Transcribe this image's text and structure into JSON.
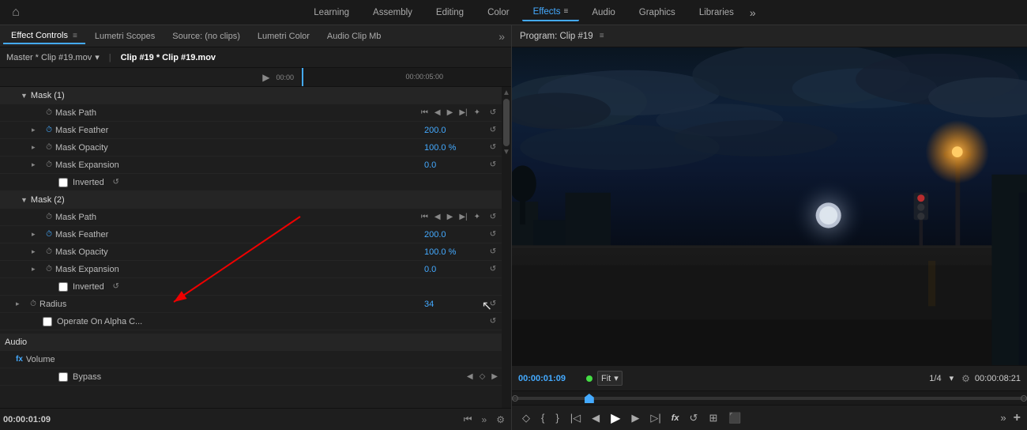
{
  "topNav": {
    "homeIcon": "⌂",
    "tabs": [
      {
        "label": "Learning",
        "active": false
      },
      {
        "label": "Assembly",
        "active": false
      },
      {
        "label": "Editing",
        "active": false
      },
      {
        "label": "Color",
        "active": false
      },
      {
        "label": "Effects",
        "active": true
      },
      {
        "label": "Audio",
        "active": false
      },
      {
        "label": "Graphics",
        "active": false
      },
      {
        "label": "Libraries",
        "active": false
      }
    ],
    "moreIcon": "»"
  },
  "leftPanel": {
    "tabs": [
      {
        "label": "Effect Controls",
        "active": true,
        "hasMenu": true
      },
      {
        "label": "Lumetri Scopes",
        "active": false
      },
      {
        "label": "Source: (no clips)",
        "active": false
      },
      {
        "label": "Lumetri Color",
        "active": false
      },
      {
        "label": "Audio Clip Mb",
        "active": false
      }
    ],
    "moreIcon": "»",
    "clipSelector": "Master * Clip #19.mov",
    "activeClip": "Clip #19 * Clip #19.mov",
    "playIcon": "▶",
    "timeStart": "00:00",
    "timeMid": "00:00:05:00",
    "mask1": {
      "title": "Mask (1)",
      "maskPath": {
        "label": "Mask Path",
        "controls": [
          "⏮",
          "◀",
          "▶",
          "▶|",
          "✦"
        ]
      },
      "maskFeather": {
        "label": "Mask Feather",
        "value": "200.0"
      },
      "maskOpacity": {
        "label": "Mask Opacity",
        "value": "100.0 %"
      },
      "maskExpansion": {
        "label": "Mask Expansion",
        "value": "0.0"
      },
      "inverted": {
        "label": "Inverted",
        "checked": false
      }
    },
    "mask2": {
      "title": "Mask (2)",
      "maskPath": {
        "label": "Mask Path",
        "controls": [
          "⏮",
          "◀",
          "▶",
          "▶|",
          "✦"
        ]
      },
      "maskFeather": {
        "label": "Mask Feather",
        "value": "200.0"
      },
      "maskOpacity": {
        "label": "Mask Opacity",
        "value": "100.0 %"
      },
      "maskExpansion": {
        "label": "Mask Expansion",
        "value": "0.0"
      },
      "inverted": {
        "label": "Inverted",
        "checked": false
      }
    },
    "radius": {
      "label": "Radius",
      "value": "34"
    },
    "operateOnAlpha": {
      "label": "Operate On Alpha C...",
      "checked": false
    },
    "audio": {
      "sectionLabel": "Audio",
      "fxLabel": "fx",
      "volumeLabel": "Volume",
      "bypassLabel": "Bypass",
      "bypassChecked": false
    },
    "bottomTime": "00:00:01:09",
    "bottomMoreIcon": "»"
  },
  "rightPanel": {
    "title": "Program: Clip #19",
    "menuIcon": "≡",
    "monitorTime": "00:00:01:09",
    "statusDot": "green",
    "fitLabel": "Fit",
    "fraction": "1/4",
    "endTime": "00:00:08:21",
    "wrenchIcon": "🔧",
    "playheadPos": "15%"
  },
  "icons": {
    "chevronDown": "▾",
    "chevronRight": "▸",
    "chevronLeft": "◂",
    "stopwatch": "⏱",
    "reset": "↺",
    "home": "⌂",
    "play": "▶",
    "pause": "⏸",
    "skipBack": "⏮",
    "stepBack": "◀",
    "stepForward": "▶",
    "skipForward": "⏭",
    "wrench": "⚙",
    "addMarker": "◇",
    "inPoint": "{",
    "outPoint": "}",
    "stepFrameBack": "◁|",
    "stepFrameForward": "|▷",
    "rewind": "⟨⟨",
    "fastForward": "⟩⟩"
  }
}
